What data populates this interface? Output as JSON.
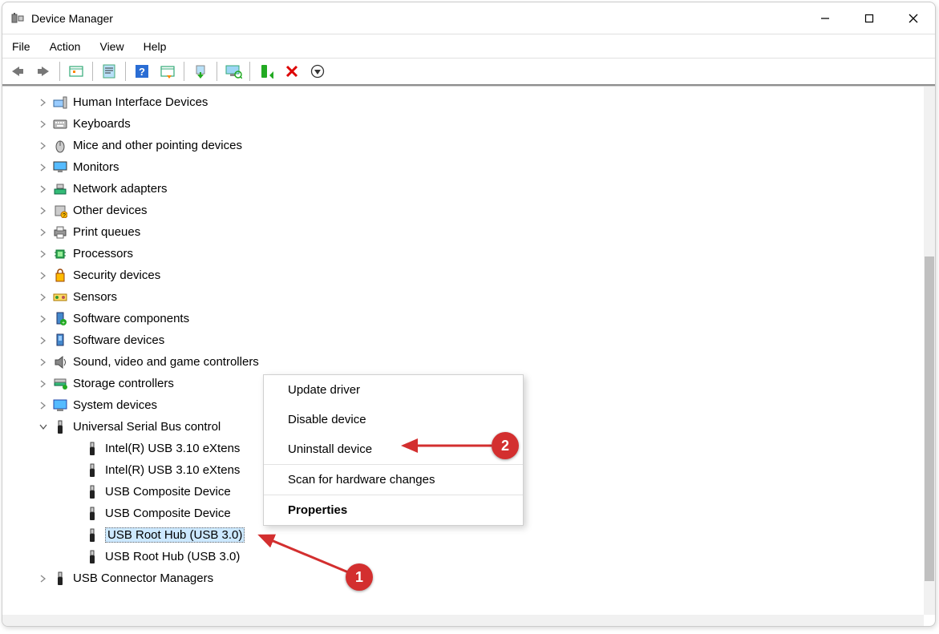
{
  "window": {
    "title": "Device Manager"
  },
  "menu": {
    "file": "File",
    "action": "Action",
    "view": "View",
    "help": "Help"
  },
  "tree": {
    "nodes": [
      {
        "label": "Human Interface Devices",
        "icon": "hid"
      },
      {
        "label": "Keyboards",
        "icon": "keyboard"
      },
      {
        "label": "Mice and other pointing devices",
        "icon": "mouse"
      },
      {
        "label": "Monitors",
        "icon": "monitor"
      },
      {
        "label": "Network adapters",
        "icon": "network"
      },
      {
        "label": "Other devices",
        "icon": "other"
      },
      {
        "label": "Print queues",
        "icon": "printer"
      },
      {
        "label": "Processors",
        "icon": "cpu"
      },
      {
        "label": "Security devices",
        "icon": "security"
      },
      {
        "label": "Sensors",
        "icon": "sensor"
      },
      {
        "label": "Software components",
        "icon": "swcomp"
      },
      {
        "label": "Software devices",
        "icon": "swdev"
      },
      {
        "label": "Sound, video and game controllers",
        "icon": "sound"
      },
      {
        "label": "Storage controllers",
        "icon": "storage"
      },
      {
        "label": "System devices",
        "icon": "system"
      }
    ],
    "usb_cat": {
      "label": "Universal Serial Bus control",
      "icon": "usb"
    },
    "usb_children": [
      {
        "label": "Intel(R) USB 3.10 eXtens"
      },
      {
        "label": "Intel(R) USB 3.10 eXtens"
      },
      {
        "label": "USB Composite Device"
      },
      {
        "label": "USB Composite Device"
      },
      {
        "label": "USB Root Hub (USB 3.0)",
        "selected": true
      },
      {
        "label": "USB Root Hub (USB 3.0)"
      }
    ],
    "bottom_node": {
      "label": "USB Connector Managers",
      "icon": "usb"
    }
  },
  "context_menu": {
    "items": [
      "Update driver",
      "Disable device",
      "Uninstall device"
    ],
    "scan": "Scan for hardware changes",
    "properties": "Properties"
  },
  "annotations": {
    "step1": "1",
    "step2": "2"
  }
}
